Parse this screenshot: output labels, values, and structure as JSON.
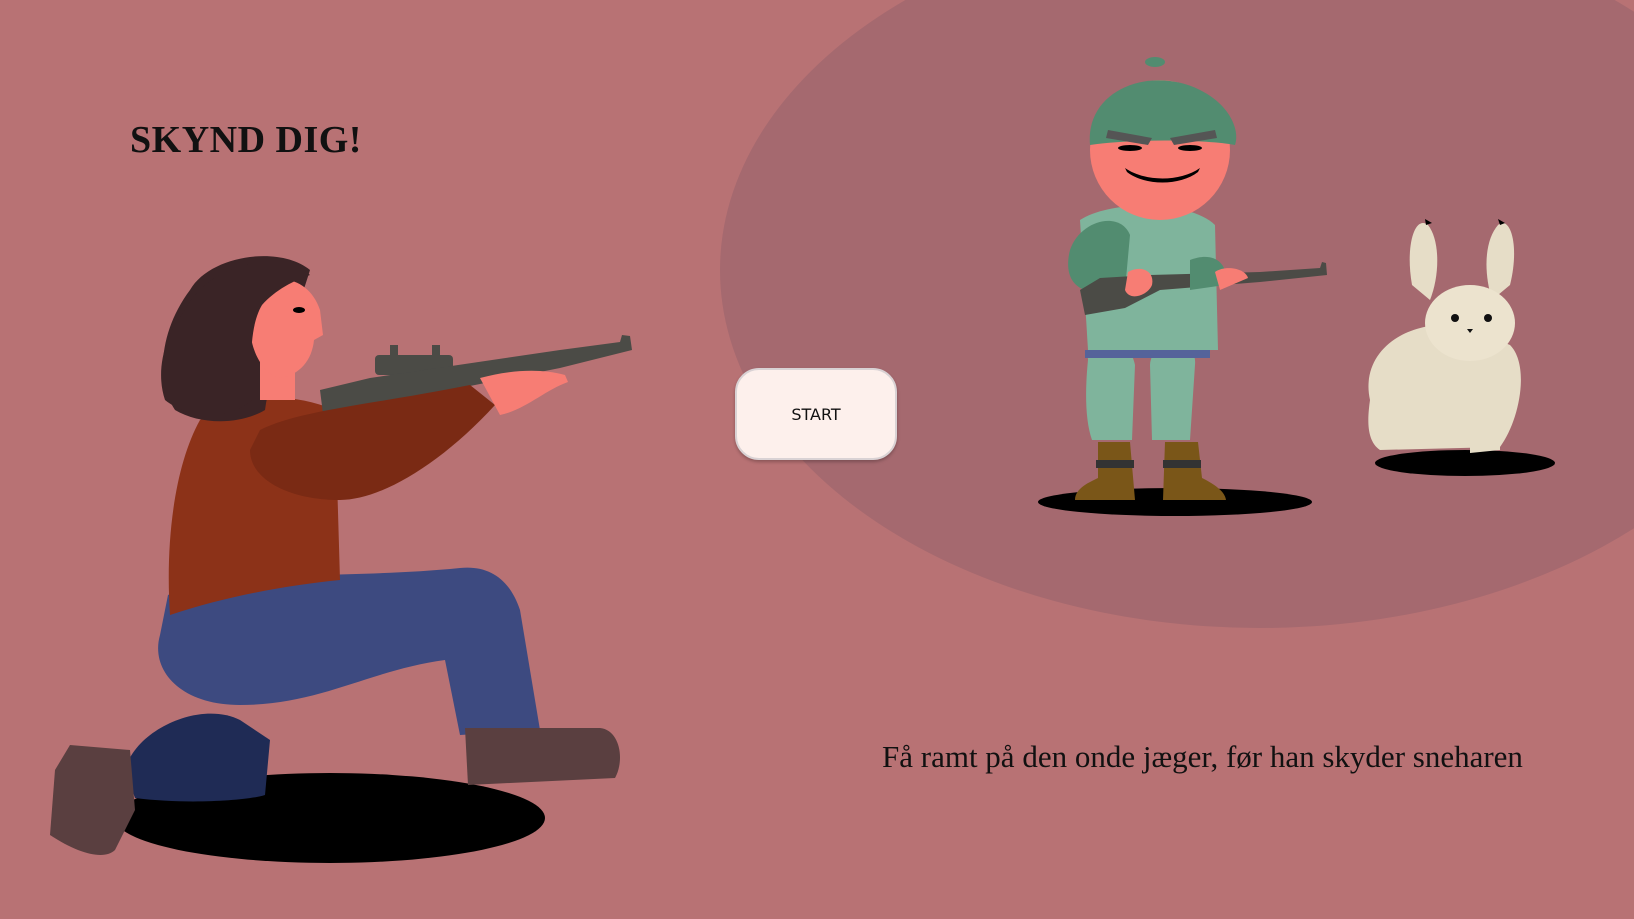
{
  "game": {
    "title": "SKYND DIG!",
    "start_label": "START",
    "instructions": "Få ramt på den onde jæger, før han skyder sneharen"
  },
  "colors": {
    "background": "#b87274",
    "arena": "#a5696f",
    "button": "#fdf0ec",
    "player_sweater": "#8c3218",
    "player_jeans": "#3d4a80",
    "player_hair": "#3a2426",
    "hunter_uniform": "#7fb49c",
    "hunter_cap": "#528c70",
    "hunter_face": "#f77d74",
    "hare_fur": "#e6ddc7",
    "rifle": "#4b4b46",
    "shadow": "#000000"
  },
  "icons": {
    "player": "kneeling-shooter",
    "enemy": "evil-hunter",
    "target": "snow-hare"
  }
}
